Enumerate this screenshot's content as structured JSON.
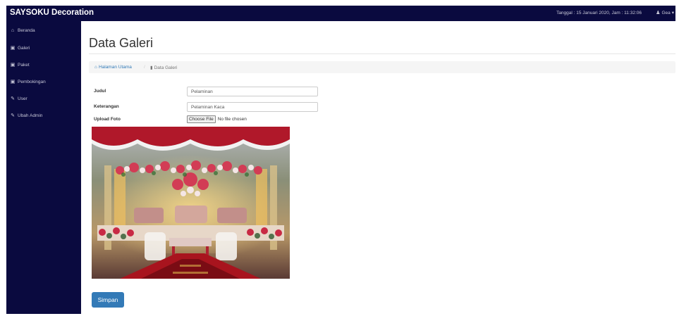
{
  "app": {
    "brand": "SAYSOKU Decoration"
  },
  "topbar": {
    "info": "Tanggal : 15 Januari 2020, Jam : 11:32:06",
    "user": "Gea"
  },
  "sidebar": {
    "items": [
      {
        "label": "Beranda",
        "icon": "home-icon"
      },
      {
        "label": "Galeri",
        "icon": "image-icon"
      },
      {
        "label": "Paket",
        "icon": "image-icon"
      },
      {
        "label": "Pembokingan",
        "icon": "image-icon"
      },
      {
        "label": "User",
        "icon": "edit-icon"
      },
      {
        "label": "Ubah Admin",
        "icon": "edit-icon"
      }
    ]
  },
  "page": {
    "title": "Data Galeri"
  },
  "breadcrumb": {
    "home": "Halaman Utama",
    "separator": "/",
    "current": "Data Galeri"
  },
  "form": {
    "judul_label": "Judul",
    "judul_value": "Pelaminan",
    "keterangan_label": "Keterangan",
    "keterangan_value": "Pelaminan Kaca",
    "upload_label": "Upload Foto",
    "file_button": "Choose File",
    "file_status": "No file chosen",
    "submit_label": "Simpan"
  },
  "colors": {
    "navbar": "#0a0a3f",
    "primary": "#337ab7"
  }
}
